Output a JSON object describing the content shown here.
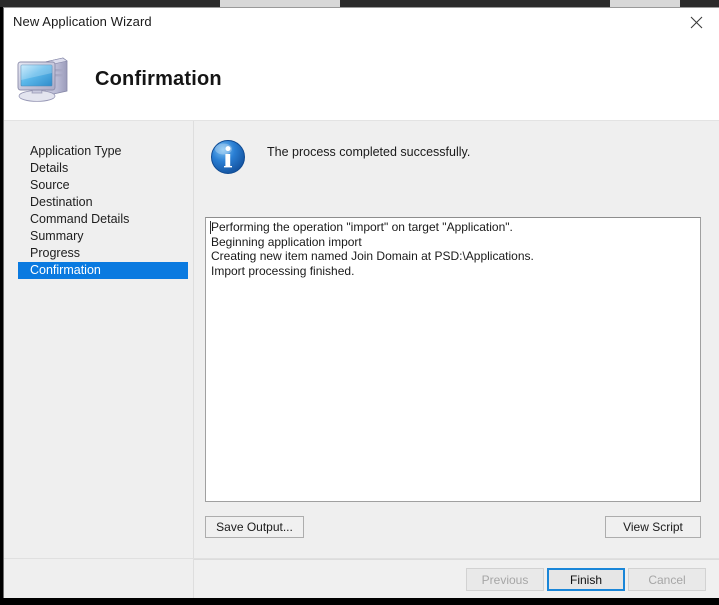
{
  "window": {
    "title": "New Application Wizard",
    "close_icon": "close-icon"
  },
  "header": {
    "icon": "computer-icon",
    "page_title": "Confirmation"
  },
  "sidebar": {
    "items": [
      {
        "label": "Application Type",
        "current": false
      },
      {
        "label": "Details",
        "current": false
      },
      {
        "label": "Source",
        "current": false
      },
      {
        "label": "Destination",
        "current": false
      },
      {
        "label": "Command Details",
        "current": false
      },
      {
        "label": "Summary",
        "current": false
      },
      {
        "label": "Progress",
        "current": false
      },
      {
        "label": "Confirmation",
        "current": true
      }
    ],
    "highlight_color": "#0a7ae0"
  },
  "content": {
    "status_icon": "information-icon",
    "status_message": "The process completed successfully.",
    "output_lines": [
      "Performing the operation \"import\" on target \"Application\".",
      "Beginning application import",
      "Creating new item named Join Domain at PSD:\\Applications.",
      "Import processing finished."
    ],
    "save_output_label": "Save Output...",
    "view_script_label": "View Script"
  },
  "footer": {
    "previous_label": "Previous",
    "finish_label": "Finish",
    "cancel_label": "Cancel",
    "focus_color": "#1a86d8"
  }
}
